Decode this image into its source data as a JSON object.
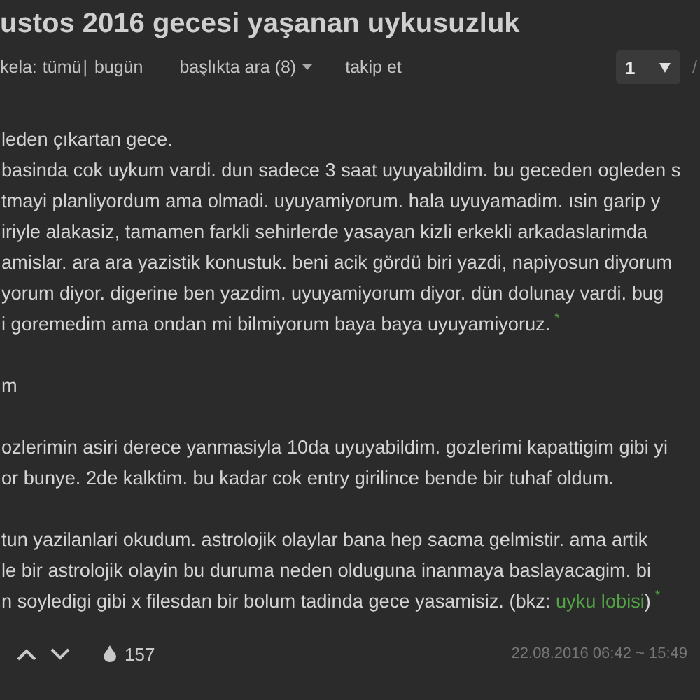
{
  "title": "ustos 2016 gecesi yaşanan uykusuzluk",
  "toolbar": {
    "label": "kela:",
    "filters": [
      {
        "label": "tümü"
      },
      {
        "label": "bugün"
      }
    ],
    "separator": "|",
    "search": "başlıkta ara (8)",
    "follow": "takip et",
    "page": "1",
    "page_sep": "/"
  },
  "entry": {
    "paragraphs": [
      {
        "lines": [
          {
            "text": "leden çıkartan gece."
          },
          {
            "text": "basinda cok uykum vardi. dun sadece 3 saat uyuyabildim. bu geceden ogleden s"
          },
          {
            "text": "tmayi planliyordum ama olmadi. uyuyamiyorum. hala uyuyamadim. ısin garip y"
          },
          {
            "text": "iriyle alakasiz, tamamen farkli sehirlerde yasayan kizli erkekli arkadaslarimda"
          },
          {
            "text": "amislar. ara ara yazistik konustuk. beni acik gördü biri yazdi, napiyosun diyorum"
          },
          {
            "text": "yorum diyor. digerine ben yazdim. uyuyamiyorum diyor. dün dolunay vardi. bug"
          },
          {
            "text": "i goremedim ama ondan mi bilmiyorum baya baya uyuyamiyoruz.",
            "footnote": "*"
          }
        ]
      },
      {
        "lines": [
          {
            "text": "m"
          }
        ]
      },
      {
        "lines": [
          {
            "text": "ozlerimin asiri derece yanmasiyla 10da uyuyabildim. gozlerimi kapattigim gibi yi"
          },
          {
            "text": "or bunye. 2de kalktim. bu kadar cok entry girilince bende bir tuhaf oldum."
          }
        ]
      },
      {
        "lines": [
          {
            "text": "tun yazilanlari okudum. astrolojik olaylar bana hep sacma gelmistir. ama artik"
          },
          {
            "text": "le bir astrolojik olayin bu duruma neden olduguna inanmaya baslayacagim. bi"
          },
          {
            "text": "n soyledigi gibi x filesdan bir bolum tadinda gece yasamisiz. (bkz: ",
            "link": "uyku lobisi",
            "after": ")",
            "footnote": "*"
          }
        ]
      }
    ],
    "favorites": "157",
    "date": "22.08.2016 06:42 ~ 15:49"
  }
}
